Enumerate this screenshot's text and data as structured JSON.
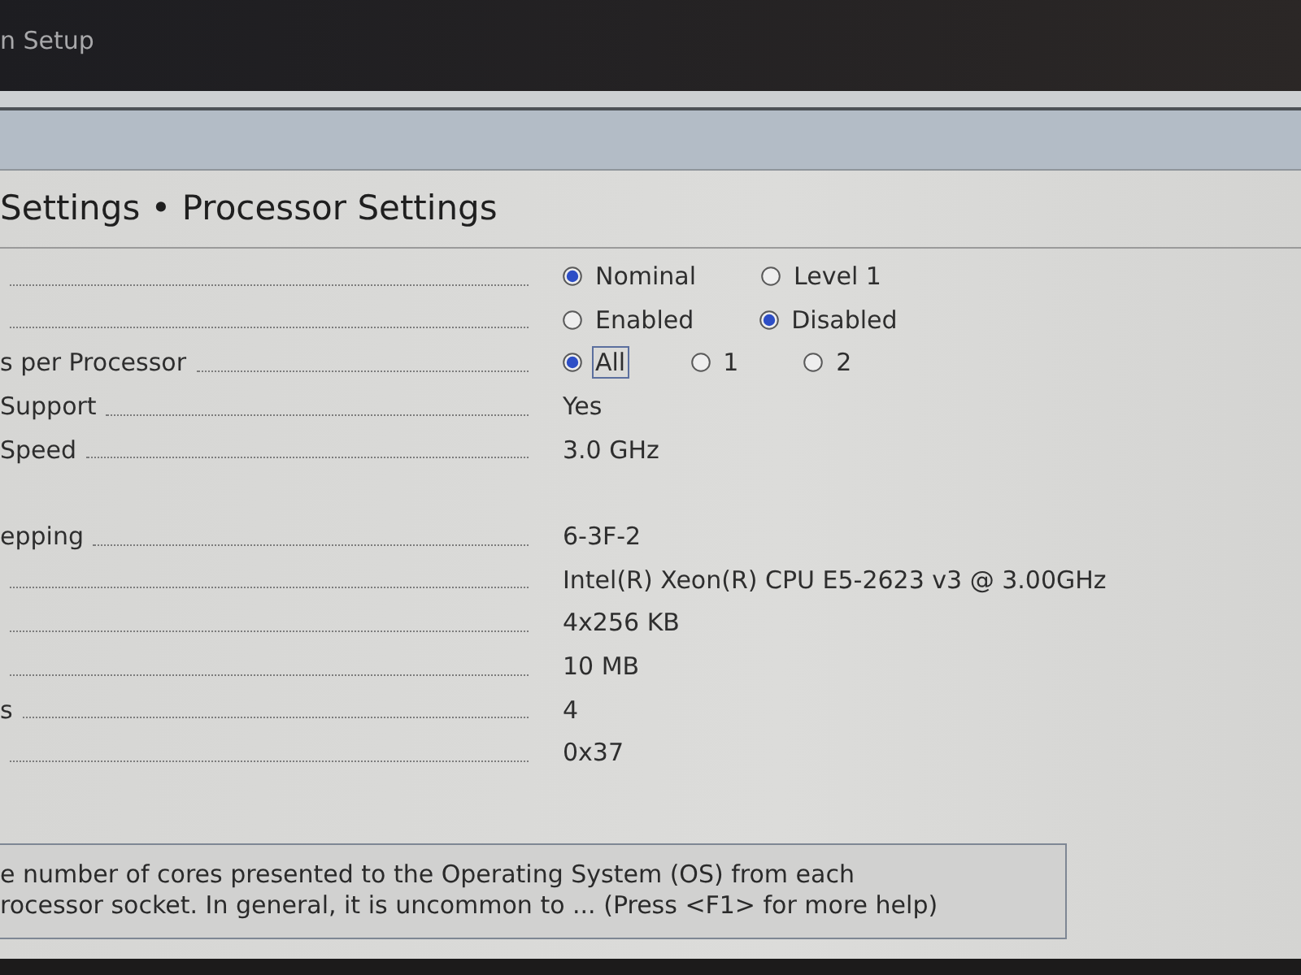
{
  "header": {
    "title": "n Setup"
  },
  "page": {
    "title": "Settings • Processor Settings"
  },
  "groups": [
    {
      "rows": [
        {
          "kind": "radio",
          "options": [
            {
              "label": "Nominal",
              "selected": true,
              "focused": false
            },
            {
              "label": "Level 1",
              "selected": false,
              "focused": false
            }
          ]
        },
        {
          "kind": "radio",
          "options": [
            {
              "label": "Enabled",
              "selected": false,
              "focused": false
            },
            {
              "label": "Disabled",
              "selected": true,
              "focused": false
            }
          ]
        },
        {
          "kind": "radio",
          "label": "s per Processor",
          "options": [
            {
              "label": "All",
              "selected": true,
              "focused": true
            },
            {
              "label": "1",
              "selected": false,
              "focused": false
            },
            {
              "label": "2",
              "selected": false,
              "focused": false
            }
          ]
        },
        {
          "kind": "value",
          "label": "Support",
          "value": "Yes"
        },
        {
          "kind": "value",
          "label": "Speed",
          "value": "3.0 GHz"
        }
      ]
    },
    {
      "rows": [
        {
          "kind": "value",
          "label": "epping",
          "value": "6-3F-2"
        },
        {
          "kind": "value",
          "value": "Intel(R) Xeon(R) CPU E5-2623 v3 @ 3.00GHz"
        },
        {
          "kind": "value",
          "value": "4x256 KB"
        },
        {
          "kind": "value",
          "value": "10 MB"
        },
        {
          "kind": "value",
          "label": "s",
          "value": "4"
        },
        {
          "kind": "value",
          "value": "0x37"
        }
      ]
    }
  ],
  "help": {
    "lines": [
      "e number of cores presented to the Operating System (OS) from each",
      "rocessor socket. In general, it is uncommon to ... (Press <F1> for more help)"
    ]
  }
}
